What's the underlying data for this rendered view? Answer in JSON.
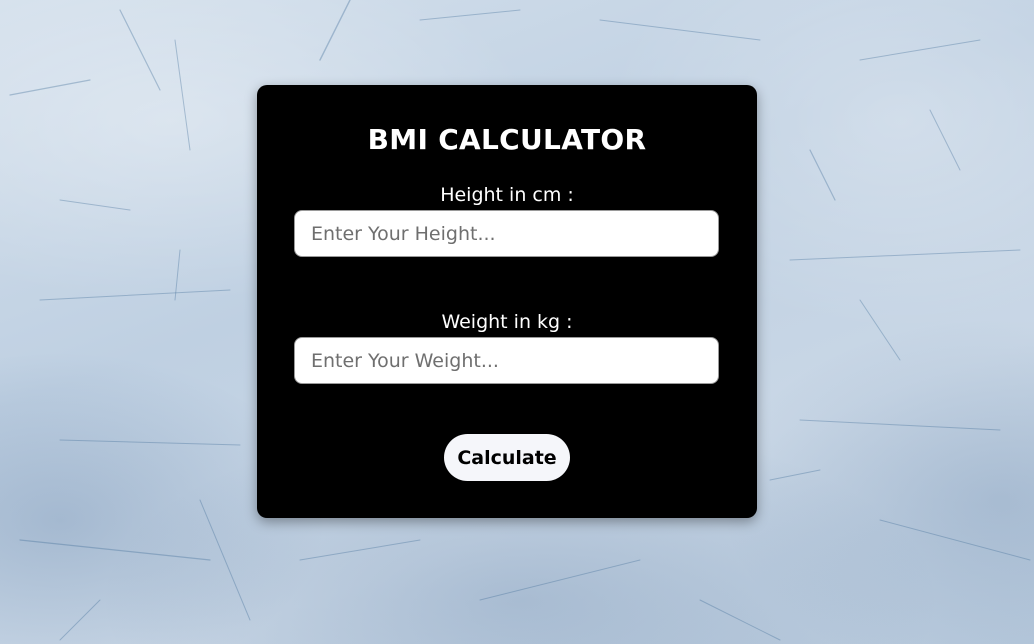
{
  "form": {
    "title": "BMI CALCULATOR",
    "height_label": "Height in cm :",
    "height_placeholder": "Enter Your Height...",
    "height_value": "",
    "weight_label": "Weight in kg :",
    "weight_placeholder": "Enter Your Weight...",
    "weight_value": "",
    "calculate_label": "Calculate"
  },
  "colors": {
    "card_background": "#000000",
    "text": "#ffffff",
    "button_background": "#f5f6fa",
    "page_background": "#c5d4e4"
  }
}
